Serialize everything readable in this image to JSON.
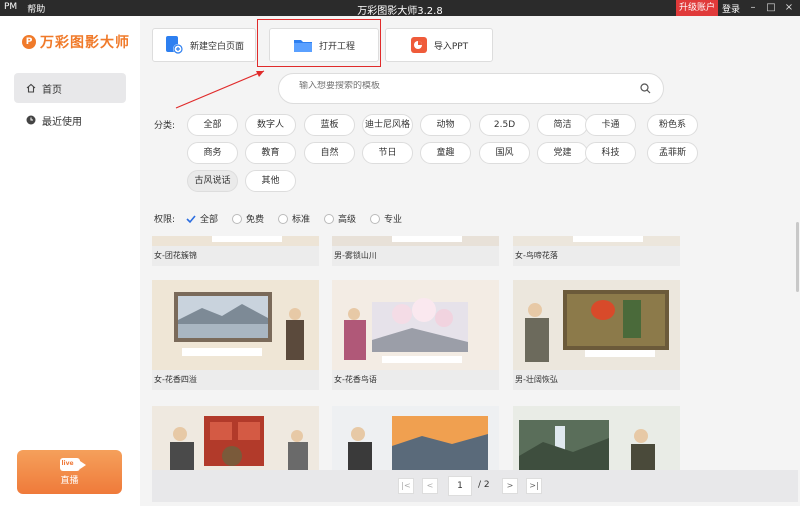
{
  "titlebar": {
    "app_icon": "PM",
    "menu_help": "帮助",
    "title": "万彩图影大师3.2.8",
    "upgrade": "升级账户",
    "login": "登录",
    "minimize": "–",
    "maximize": "□",
    "close": "×"
  },
  "sidebar": {
    "logo_mark": "P",
    "logo_text": "万彩图影大师",
    "items": [
      {
        "label": "首页",
        "icon": "home-icon"
      },
      {
        "label": "最近使用",
        "icon": "clock-icon"
      }
    ],
    "live_label": "直播",
    "live_badge": "live"
  },
  "toolbar": {
    "new_blank": "新建空白页面",
    "open_project": "打开工程",
    "import_ppt": "导入PPT"
  },
  "search": {
    "placeholder": "输入想要搜索的模板"
  },
  "categories": {
    "label": "分类:",
    "tags": [
      "全部",
      "数字人",
      "蓝板",
      "迪士尼风格",
      "动物",
      "2.5D",
      "简洁",
      "卡通",
      "粉色系",
      "商务",
      "教育",
      "自然",
      "节日",
      "童趣",
      "国风",
      "党建",
      "科技",
      "孟菲斯",
      "古风说话",
      "其他"
    ],
    "selected": "古风说话"
  },
  "permission": {
    "label": "权限:",
    "options": [
      "全部",
      "免费",
      "标准",
      "高级",
      "专业"
    ],
    "selected": "全部"
  },
  "templates": [
    {
      "title": "女-团花簇锦"
    },
    {
      "title": "男-雾锁山川"
    },
    {
      "title": "女-鸟啼花落"
    },
    {
      "title": "女-花香四溢"
    },
    {
      "title": "女-花香鸟语"
    },
    {
      "title": "男-壮阔恢弘"
    }
  ],
  "pager": {
    "current": "1",
    "total": "/ 2",
    "first": "|<",
    "prev": "<",
    "next": ">",
    "last": ">|"
  },
  "colors": {
    "accent": "#f07a2a",
    "upgrade": "#e03a3a",
    "check": "#2b6de0",
    "highlight": "#e02b2b"
  }
}
